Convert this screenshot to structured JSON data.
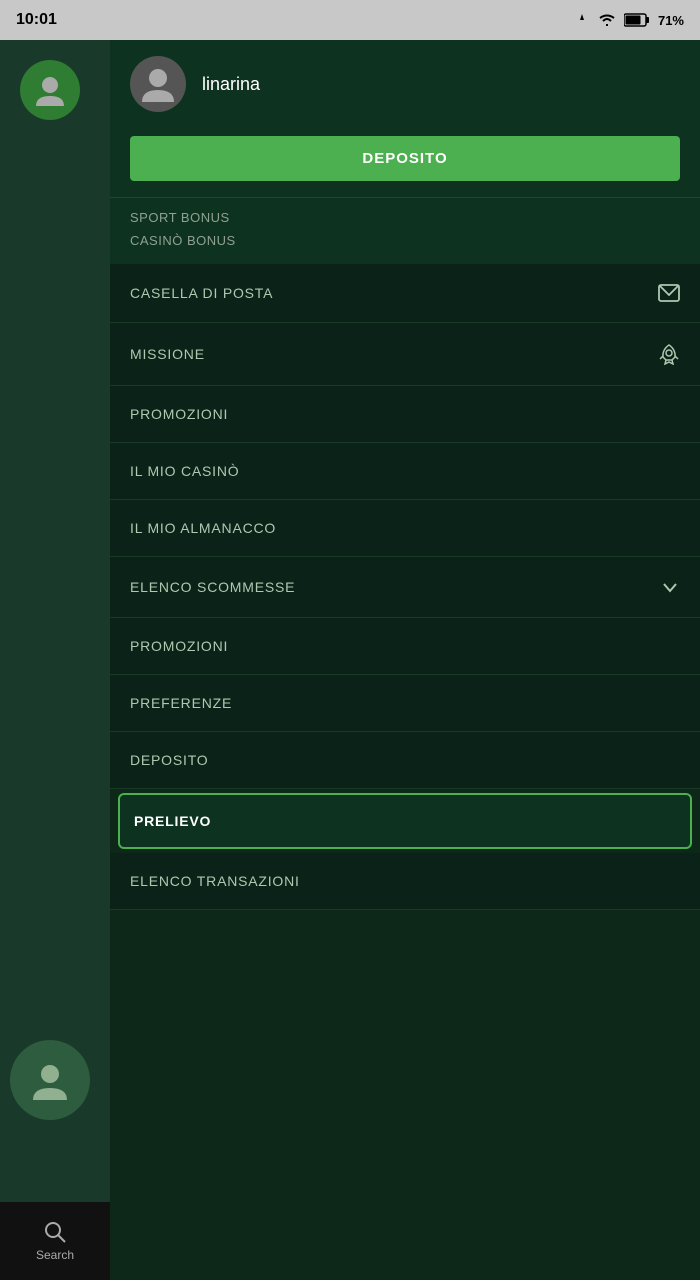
{
  "statusBar": {
    "time": "10:01",
    "battery": "71%",
    "batteryIcon": "battery-icon",
    "wifiIcon": "wifi-icon",
    "signalIcon": "signal-icon"
  },
  "leftPanel": {
    "searchLabel": "Search"
  },
  "drawer": {
    "profile": {
      "username": "linarina",
      "avatarIcon": "person-icon"
    },
    "depositButton": {
      "label": "DEPOSITO"
    },
    "bonusItems": [
      {
        "label": "SPORT BONUS"
      },
      {
        "label": "CASINÒ BONUS"
      }
    ],
    "menuItems": [
      {
        "id": "casella-di-posta",
        "label": "CASELLA DI POSTA",
        "icon": "mail-icon",
        "hasIcon": true,
        "active": false
      },
      {
        "id": "missione",
        "label": "MISSIONE",
        "icon": "rocket-icon",
        "hasIcon": true,
        "active": false
      },
      {
        "id": "promozioni-1",
        "label": "PROMOZIONI",
        "icon": "",
        "hasIcon": false,
        "active": false
      },
      {
        "id": "il-mio-casino",
        "label": "IL MIO CASINÒ",
        "icon": "",
        "hasIcon": false,
        "active": false
      },
      {
        "id": "il-mio-almanacco",
        "label": "IL MIO ALMANACCO",
        "icon": "",
        "hasIcon": false,
        "active": false
      },
      {
        "id": "elenco-scommesse",
        "label": "ELENCO SCOMMESSE",
        "icon": "chevron-down-icon",
        "hasIcon": true,
        "active": false
      },
      {
        "id": "promozioni-2",
        "label": "PROMOZIONI",
        "icon": "",
        "hasIcon": false,
        "active": false
      },
      {
        "id": "preferenze",
        "label": "PREFERENZE",
        "icon": "",
        "hasIcon": false,
        "active": false
      },
      {
        "id": "deposito",
        "label": "DEPOSITO",
        "icon": "",
        "hasIcon": false,
        "active": false
      },
      {
        "id": "prelievo",
        "label": "PRELIEVO",
        "icon": "",
        "hasIcon": false,
        "active": true
      },
      {
        "id": "elenco-transazioni",
        "label": "ELENCO TRANSAZIONI",
        "icon": "",
        "hasIcon": false,
        "active": false
      }
    ]
  }
}
